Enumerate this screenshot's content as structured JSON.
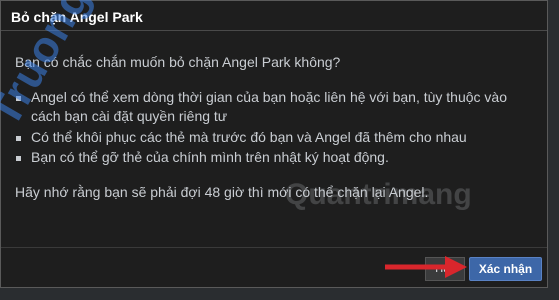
{
  "dialog": {
    "title": "Bỏ chặn Angel Park",
    "question": "Bạn có chắc chắn muốn bỏ chặn Angel Park không?",
    "bullets": [
      "Angel có thể xem dòng thời gian của bạn hoặc liên hệ với bạn, tùy thuộc vào cách bạn cài đặt quyền riêng tư",
      "Có thể khôi phục các thẻ mà trước đó bạn và Angel đã thêm cho nhau",
      "Bạn có thể gỡ thẻ của chính mình trên nhật ký hoạt động."
    ],
    "note": "Hãy nhớ rằng bạn sẽ phải đợi 48 giờ thì mới có thể chặn lại Angel.",
    "cancel_label": "Hủy",
    "confirm_label": "Xác nhận"
  },
  "watermarks": {
    "left": "Truongthi.top",
    "right": "Quantrimang"
  },
  "colors": {
    "dialog_bg": "#1e1e1e",
    "confirm_bg": "#3d67a8",
    "arrow": "#d9262c"
  }
}
